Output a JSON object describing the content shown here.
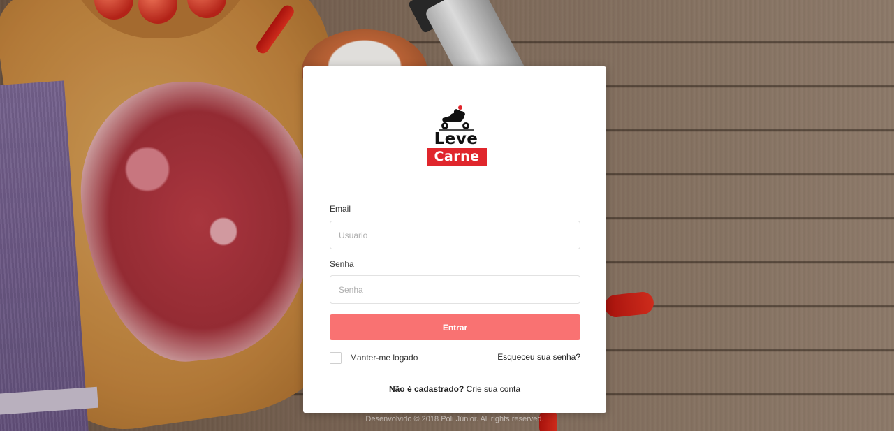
{
  "logo": {
    "line1": "Leve",
    "line2": "Carne",
    "colors": {
      "brand_red": "#e0262c",
      "text_dark": "#111111"
    }
  },
  "form": {
    "email_label": "Email",
    "email_placeholder": "Usuario",
    "email_value": "",
    "password_label": "Senha",
    "password_placeholder": "Senha",
    "password_value": "",
    "submit_label": "Entrar",
    "remember_label": "Manter-me logado",
    "remember_checked": false,
    "forgot_label": "Esqueceu sua senha?"
  },
  "signup": {
    "question": "Não é cadastrado?",
    "link": "Crie sua conta"
  },
  "footer": {
    "text": "Desenvolvido © 2018 Poli Júnior. All rights reserved."
  },
  "colors": {
    "button": "#f97272",
    "card": "#ffffff"
  },
  "icons": {
    "logo_illustration": "scooter-delivery-icon"
  }
}
